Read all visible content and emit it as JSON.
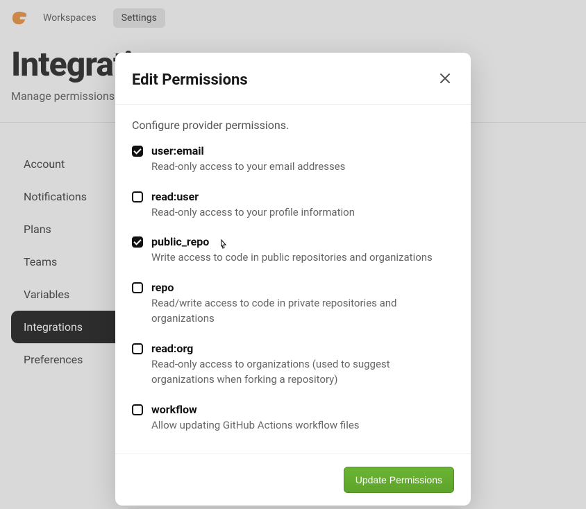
{
  "header": {
    "nav": {
      "workspaces": "Workspaces",
      "settings": "Settings"
    }
  },
  "page": {
    "title": "Integrations",
    "subtitle": "Manage permissions for git providers"
  },
  "sidebar": {
    "items": [
      {
        "label": "Account"
      },
      {
        "label": "Notifications"
      },
      {
        "label": "Plans"
      },
      {
        "label": "Teams"
      },
      {
        "label": "Variables"
      },
      {
        "label": "Integrations"
      },
      {
        "label": "Preferences"
      }
    ]
  },
  "modal": {
    "title": "Edit Permissions",
    "description": "Configure provider permissions.",
    "update_label": "Update Permissions",
    "permissions": [
      {
        "key": "user:email",
        "desc": "Read-only access to your email addresses",
        "checked": true
      },
      {
        "key": "read:user",
        "desc": "Read-only access to your profile information",
        "checked": false
      },
      {
        "key": "public_repo",
        "desc": "Write access to code in public repositories and organizations",
        "checked": true
      },
      {
        "key": "repo",
        "desc": "Read/write access to code in private repositories and organizations",
        "checked": false
      },
      {
        "key": "read:org",
        "desc": "Read-only access to organizations (used to suggest organizations when forking a repository)",
        "checked": false
      },
      {
        "key": "workflow",
        "desc": "Allow updating GitHub Actions workflow files",
        "checked": false
      }
    ]
  }
}
